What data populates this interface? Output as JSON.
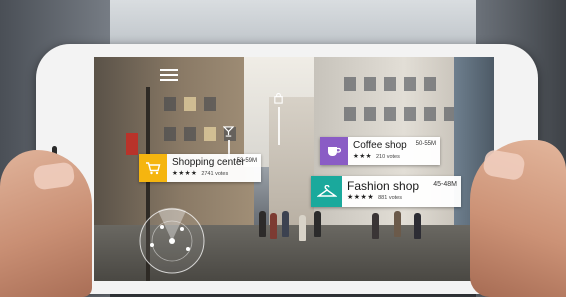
{
  "scene": {
    "description_free": true
  },
  "ar_app": {
    "poi_cards": [
      {
        "name": "Shopping center",
        "distance": "53-59M",
        "stars": "★★★★",
        "votes": "2741 votes",
        "icon": "shopping-cart-icon",
        "color": "#f5b50f"
      },
      {
        "name": "Coffee shop",
        "distance": "50-55M",
        "stars": "★★★",
        "votes": "210 votes",
        "icon": "coffee-cup-icon",
        "color": "#8a5cc5"
      },
      {
        "name": "Fashion shop",
        "distance": "45-48M",
        "stars": "★★★★",
        "votes": "881 votes",
        "icon": "clothes-hanger-icon",
        "color": "#1aa99c"
      }
    ],
    "markers": [
      {
        "icon": "cocktail-glass-icon",
        "color": "#3fa8d8"
      },
      {
        "icon": "shopping-bag-icon",
        "color": "#9058c9"
      }
    ],
    "menu_icon": "hamburger-menu-icon",
    "radar_icon": "radar-icon"
  }
}
